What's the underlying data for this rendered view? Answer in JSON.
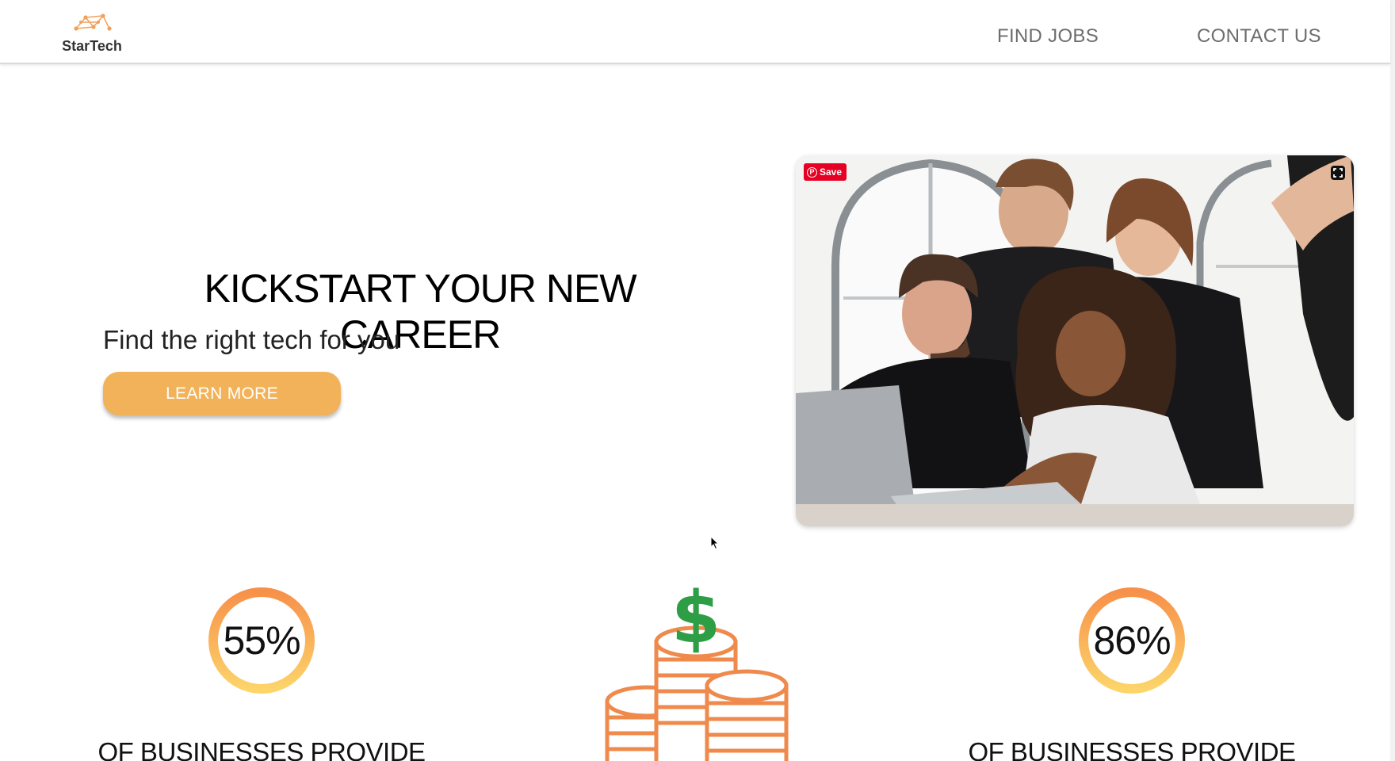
{
  "header": {
    "logo_text": "StarTech",
    "nav": [
      {
        "label": "FIND JOBS"
      },
      {
        "label": "CONTACT US"
      }
    ]
  },
  "hero": {
    "title": "KICKSTART YOUR NEW CAREER",
    "subtitle": "Find the right tech for you",
    "cta_label": "LEARN MORE",
    "pin_save_label": "Save"
  },
  "stats": [
    {
      "value": "55%",
      "progress": 1.0,
      "caption": "OF BUSINESSES PROVIDE"
    },
    {
      "icon": "money-coins-icon"
    },
    {
      "value": "86%",
      "progress": 1.0,
      "caption": "OF BUSINESSES PROVIDE"
    }
  ],
  "colors": {
    "accent": "#f2b25a",
    "ring_start": "#f7914a",
    "ring_end": "#fcd46a",
    "coin": "#ef8a4c",
    "dollar": "#2e9e46",
    "nav_text": "#6d6d6d",
    "pin_red": "#e60023"
  }
}
